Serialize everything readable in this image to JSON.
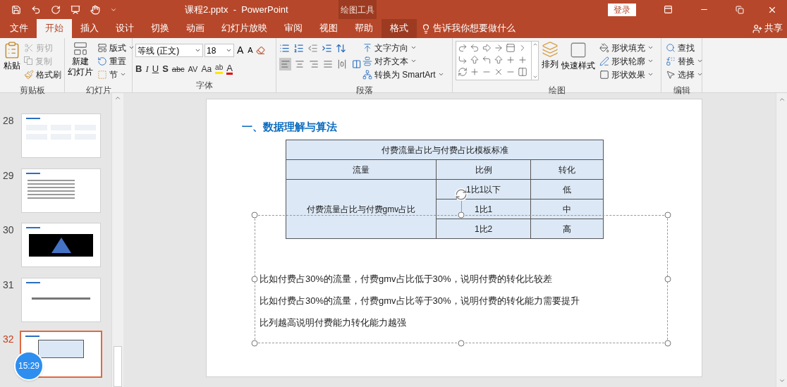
{
  "title_bar": {
    "document_title": "课程2.pptx  -  PowerPoint",
    "context_label": "绘图工具",
    "sign_in": "登录"
  },
  "tabs": [
    {
      "label": "文件",
      "selected": false,
      "kind": "normal"
    },
    {
      "label": "开始",
      "selected": true,
      "kind": "normal"
    },
    {
      "label": "插入",
      "selected": false,
      "kind": "normal"
    },
    {
      "label": "设计",
      "selected": false,
      "kind": "normal"
    },
    {
      "label": "切换",
      "selected": false,
      "kind": "normal"
    },
    {
      "label": "动画",
      "selected": false,
      "kind": "normal"
    },
    {
      "label": "幻灯片放映",
      "selected": false,
      "kind": "normal"
    },
    {
      "label": "审阅",
      "selected": false,
      "kind": "normal"
    },
    {
      "label": "视图",
      "selected": false,
      "kind": "normal"
    },
    {
      "label": "帮助",
      "selected": false,
      "kind": "normal"
    },
    {
      "label": "格式",
      "selected": false,
      "kind": "contextual"
    }
  ],
  "tell_me": "告诉我你想要做什么",
  "share": "共享",
  "clipboard": {
    "label": "剪贴板",
    "paste": "粘贴",
    "cut": {
      "label": "剪切",
      "disabled": true
    },
    "copy": {
      "label": "复制",
      "disabled": true
    },
    "format_painter": {
      "label": "格式刷",
      "disabled": false
    }
  },
  "slides_group": {
    "label": "幻灯片",
    "new_slide": "新建",
    "new_slide_2": "幻灯片",
    "layout": "版式",
    "reset": "重置",
    "section": "节"
  },
  "font": {
    "label": "字体",
    "font_name": "等线 (正文)",
    "font_size": "18",
    "grow": "A",
    "shrink": "A",
    "bold": "B",
    "italic": "I",
    "underline": "U",
    "shadow": "S",
    "strike": "abc",
    "spacing": "AV",
    "case": "Aa",
    "highlight": "ab",
    "font_color": "A"
  },
  "paragraph": {
    "label": "段落",
    "text_direction": "文字方向",
    "align_text": "对齐文本",
    "smartart": "转换为 SmartArt",
    "alignment": [
      {
        "selected": true
      },
      {
        "selected": false
      },
      {
        "selected": false
      },
      {
        "selected": false
      },
      {
        "selected": false
      }
    ]
  },
  "drawing": {
    "label": "绘图",
    "arrange": "排列",
    "quick_styles": "快速样式",
    "fill": "形状填充",
    "outline": "形状轮廓",
    "effects": "形状效果"
  },
  "editing": {
    "label": "编辑",
    "find": "查找",
    "replace": "替换",
    "select": "选择"
  },
  "slide_panel": [
    {
      "number": "28",
      "selected": false,
      "kind": "cards"
    },
    {
      "number": "29",
      "selected": false,
      "kind": "text"
    },
    {
      "number": "30",
      "selected": false,
      "kind": "image"
    },
    {
      "number": "31",
      "selected": false,
      "kind": "title"
    },
    {
      "number": "32",
      "selected": true,
      "kind": "table"
    }
  ],
  "slide": {
    "heading": "一、数据理解与算法",
    "table": {
      "title": "付费流量占比与付费占比模板标准",
      "columns": [
        "流量",
        "比例",
        "转化"
      ],
      "rows": [
        [
          "",
          "1比1以下",
          "低"
        ],
        [
          "付费流量占比与付费gmv占比",
          "1比1",
          "中"
        ],
        [
          "",
          "1比2",
          "高"
        ]
      ]
    },
    "paragraphs": [
      "比如付费占30%的流量，付费gmv占比低于30%，说明付费的转化比较差",
      "比如付费占30%的流量，付费gmv占比等于30%，说明付费的转化能力需要提升",
      "比列越高说明付费能力转化能力越强"
    ]
  },
  "timer": "15:29"
}
